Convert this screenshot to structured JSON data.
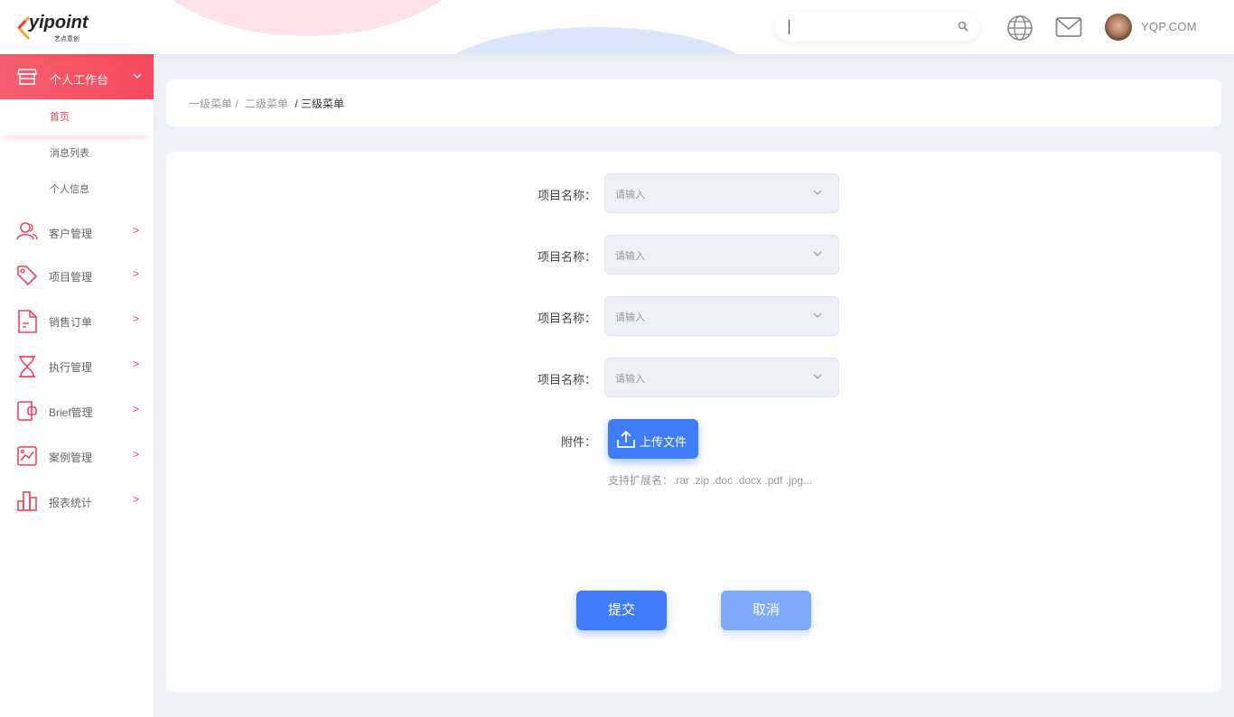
{
  "header": {
    "logo_text": "yipoint",
    "logo_sub": "艺点意创",
    "search_placeholder": "",
    "account": "YQP.COM"
  },
  "sidebar": {
    "group": {
      "label": "个人工作台",
      "icon": "store-icon"
    },
    "subitems": [
      {
        "label": "首页",
        "active": true
      },
      {
        "label": "消息列表",
        "active": false
      },
      {
        "label": "个人信息",
        "active": false
      }
    ],
    "items": [
      {
        "label": "客户管理",
        "icon": "users-icon",
        "arrow": ">"
      },
      {
        "label": "项目管理",
        "icon": "tag-icon",
        "arrow": ">"
      },
      {
        "label": "销售订单",
        "icon": "document-icon",
        "arrow": ">"
      },
      {
        "label": "执行管理",
        "icon": "hourglass-icon",
        "arrow": ">"
      },
      {
        "label": "Brief管理",
        "icon": "wallet-icon",
        "arrow": ">"
      },
      {
        "label": "案例管理",
        "icon": "image-chart-icon",
        "arrow": ">"
      },
      {
        "label": "报表统计",
        "icon": "bar-chart-icon",
        "arrow": ">"
      }
    ]
  },
  "breadcrumb": {
    "level1": "一级菜单 /",
    "level2": "二级菜单",
    "level3": "/ 三级菜单"
  },
  "form": {
    "fields": [
      {
        "label": "项目名称：",
        "placeholder": "请输入"
      },
      {
        "label": "项目名称：",
        "placeholder": "请输入"
      },
      {
        "label": "项目名称：",
        "placeholder": "请输入"
      },
      {
        "label": "项目名称：",
        "placeholder": "请输入"
      }
    ],
    "attachment_label": "附件：",
    "upload_label": "上传文件",
    "hint": "支持扩展名：.rar .zip .doc .docx .pdf .jpg...",
    "submit_label": "提交",
    "cancel_label": "取消"
  },
  "colors": {
    "accent_red": "#f0425a",
    "primary_blue": "#3f7cf7",
    "cancel_blue": "#7eaaf9"
  }
}
